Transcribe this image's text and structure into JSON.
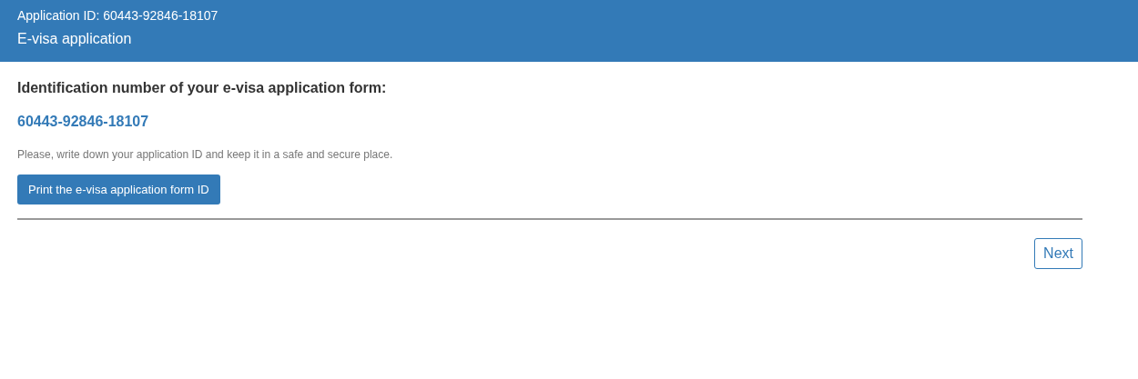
{
  "header": {
    "application_id": "Application ID: 60443-92846-18107",
    "title": "E-visa application"
  },
  "content": {
    "heading": "Identification number of your e-visa application form:",
    "id_number": "60443-92846-18107",
    "note": "Please, write down your application ID and keep it in a safe and secure place.",
    "print_button": "Print the e-visa application form ID"
  },
  "buttons": [
    "Next"
  ]
}
